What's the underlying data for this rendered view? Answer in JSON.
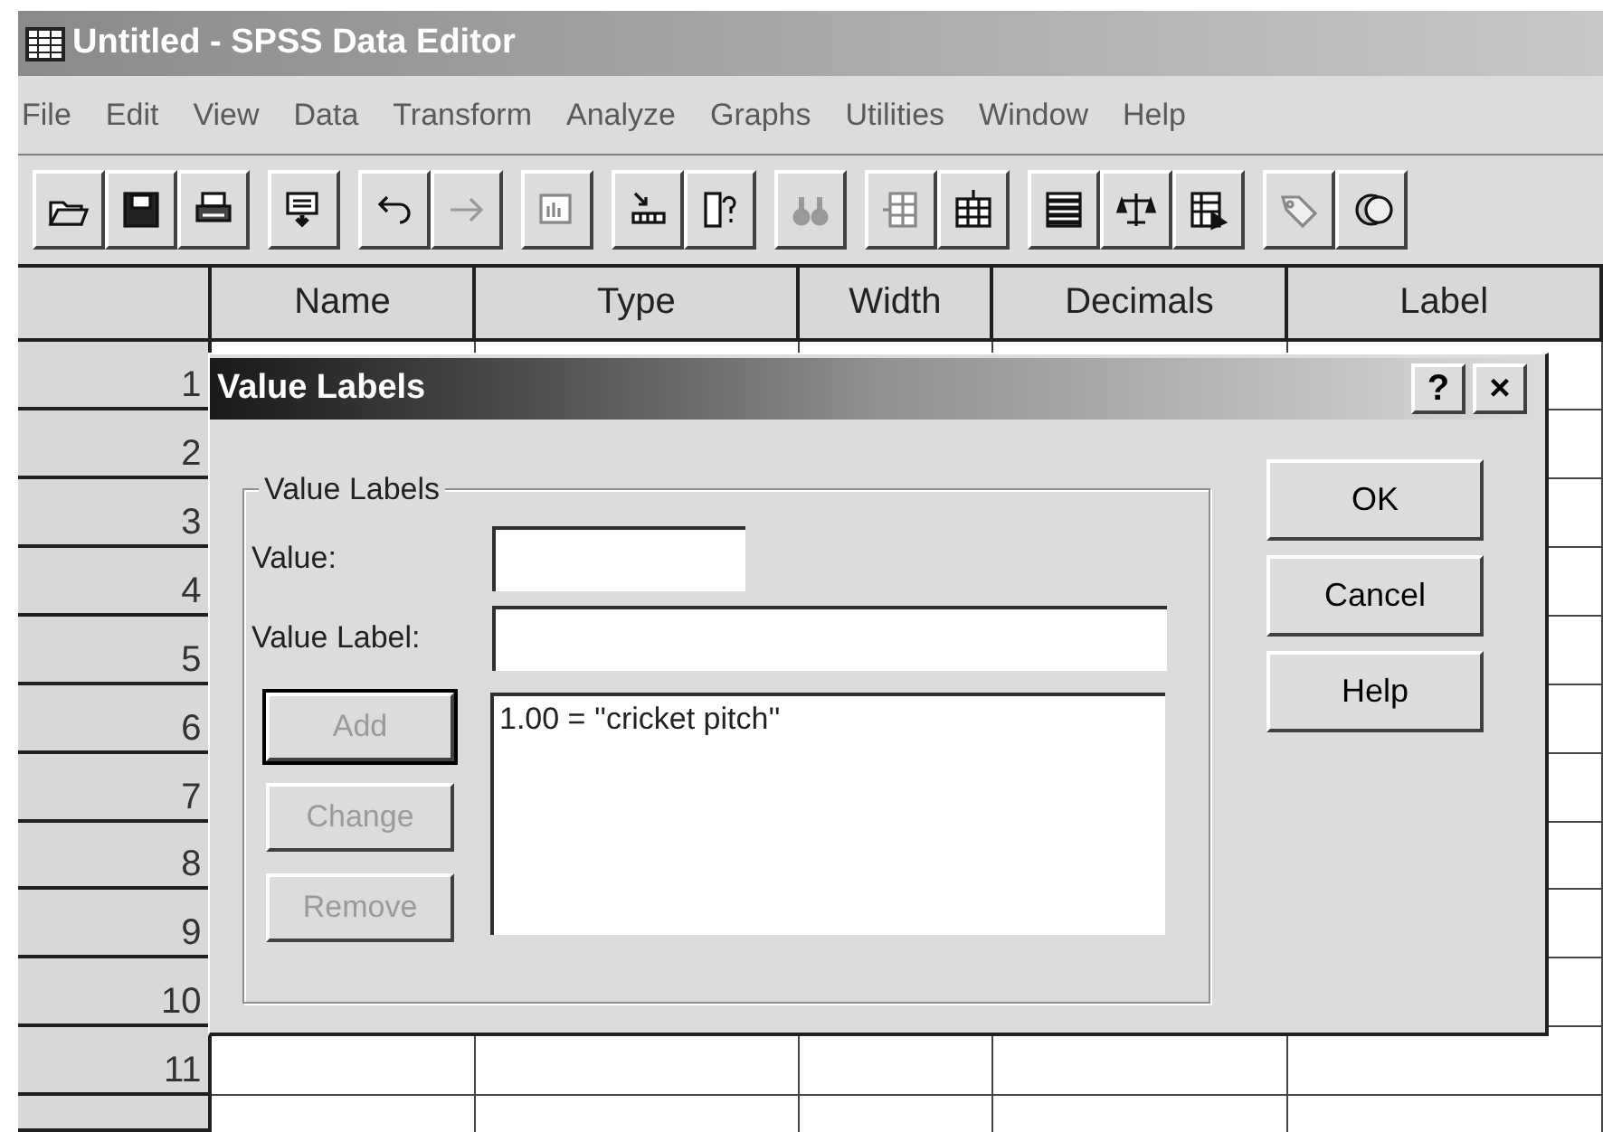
{
  "window": {
    "title": "Untitled - SPSS Data Editor"
  },
  "menu": [
    "File",
    "Edit",
    "View",
    "Data",
    "Transform",
    "Analyze",
    "Graphs",
    "Utilities",
    "Window",
    "Help"
  ],
  "grid": {
    "columns": [
      "Name",
      "Type",
      "Width",
      "Decimals",
      "Label"
    ],
    "rows": [
      "1",
      "2",
      "3",
      "4",
      "5",
      "6",
      "7",
      "8",
      "9",
      "10",
      "11"
    ]
  },
  "dialog": {
    "title": "Value Labels",
    "title_buttons": [
      "?",
      "×"
    ],
    "group": {
      "label": "Value Labels",
      "fields": [
        {
          "label": "Value:"
        },
        {
          "label": "Value Label:"
        }
      ],
      "side_buttons": [
        {
          "label": "Add",
          "disabled": true,
          "default": true
        },
        {
          "label": "Change",
          "disabled": true,
          "default": false
        },
        {
          "label": "Remove",
          "disabled": true,
          "default": false
        }
      ],
      "list": [
        "1.00 = ''cricket pitch''"
      ]
    },
    "buttons": [
      {
        "label": "OK",
        "disabled": false
      },
      {
        "label": "Cancel",
        "disabled": false
      },
      {
        "label": "Help",
        "disabled": false
      }
    ]
  }
}
